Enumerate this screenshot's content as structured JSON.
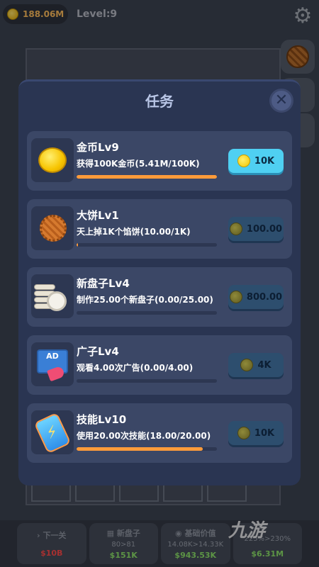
{
  "hud": {
    "coins": "188.06M",
    "level": "Level:9"
  },
  "bottom_bar": [
    {
      "title": "下一关",
      "line1": "",
      "line2": "$10B",
      "icon": "chevron-right-icon"
    },
    {
      "title": "新盘子",
      "line1": "80>81",
      "line2": "$151K",
      "icon": "grid-icon"
    },
    {
      "title": "基础价值",
      "line1": "14.08K>14.33K",
      "line2": "$943.53K",
      "icon": "gem-icon"
    },
    {
      "title": "",
      "line1": "225%>230%",
      "line2": "$6.31M",
      "icon": "bolt-icon"
    }
  ],
  "watermark": "九游",
  "dialog": {
    "title": "任务",
    "close_label": "✕",
    "tasks": [
      {
        "name": "金币Lv9",
        "desc": "获得100K金币(5.41M/100K)",
        "progress": 1.0,
        "reward": "10K",
        "claimable": true,
        "icon": "gold-coin-icon"
      },
      {
        "name": "大饼Lv1",
        "desc": "天上掉1K个馅饼(10.00/1K)",
        "progress": 0.01,
        "reward": "100.00",
        "claimable": false,
        "icon": "pie-icon"
      },
      {
        "name": "新盘子Lv4",
        "desc": "制作25.00个新盘子(0.00/25.00)",
        "progress": 0.0,
        "reward": "800.00",
        "claimable": false,
        "icon": "plates-icon"
      },
      {
        "name": "广子Lv4",
        "desc": "观看4.00次广告(0.00/4.00)",
        "progress": 0.0,
        "reward": "4K",
        "claimable": false,
        "icon": "ad-icon"
      },
      {
        "name": "技能Lv10",
        "desc": "使用20.00次技能(18.00/20.00)",
        "progress": 0.9,
        "reward": "10K",
        "claimable": false,
        "icon": "battery-icon"
      }
    ]
  },
  "colors": {
    "progress": "#ff9b3a",
    "claim_button": "#4fd0f2",
    "dialog_bg": "#2a3552",
    "card_bg": "#3b4766"
  }
}
